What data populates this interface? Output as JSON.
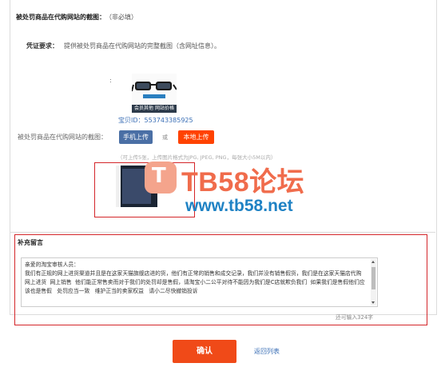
{
  "section": {
    "title": "被处罚商品在代购网站的截图：",
    "optional": "（非必填）"
  },
  "requirement": {
    "label": "凭证要求：",
    "text": "提供被处罚商品在代购网站的完整截图（含网址信息）。"
  },
  "product": {
    "colon": ":",
    "caption": "会员其他 网站价格",
    "id_label": "宝贝ID：553743385925"
  },
  "upload": {
    "label": "被处罚商品在代购网站的截图：",
    "mobile_button": "手机上传",
    "or_text": "或",
    "local_button": "本地上传",
    "hint": "（可上传5张，上传图片格式为JPG, JPEG, PNG，每张大小5M以内）"
  },
  "watermark": {
    "icon": "T",
    "brand": "TB58论坛",
    "url": "www.tb58.net"
  },
  "memo": {
    "title": "补充留言",
    "text": "亲爱的淘宝审核人员：\n我们有正规的网上进货渠道并且是在这家天猫旗舰店进的货，他们有正常的销售和成交记录，我们并没有销售假货，我们是在这家天猫店代购    网上进货  网上销售  他们能正常售卖而对于我们的处罚却是售假，请淘宝小二公平对待不能因为我们是C店就欺负我们  如果我们是售假他们应该也是售假   处罚应当一致   维护正当的卖家权益   请小二尽快撤销投诉",
    "counter": "还可输入324字"
  },
  "actions": {
    "confirm": "确认",
    "back": "返回列表"
  },
  "colors": {
    "accent": "#ff4200",
    "confirm": "#f04a18",
    "link": "#3b6fb6",
    "highlight": "#d4262a",
    "mobile_button": "#4a6fa5"
  }
}
